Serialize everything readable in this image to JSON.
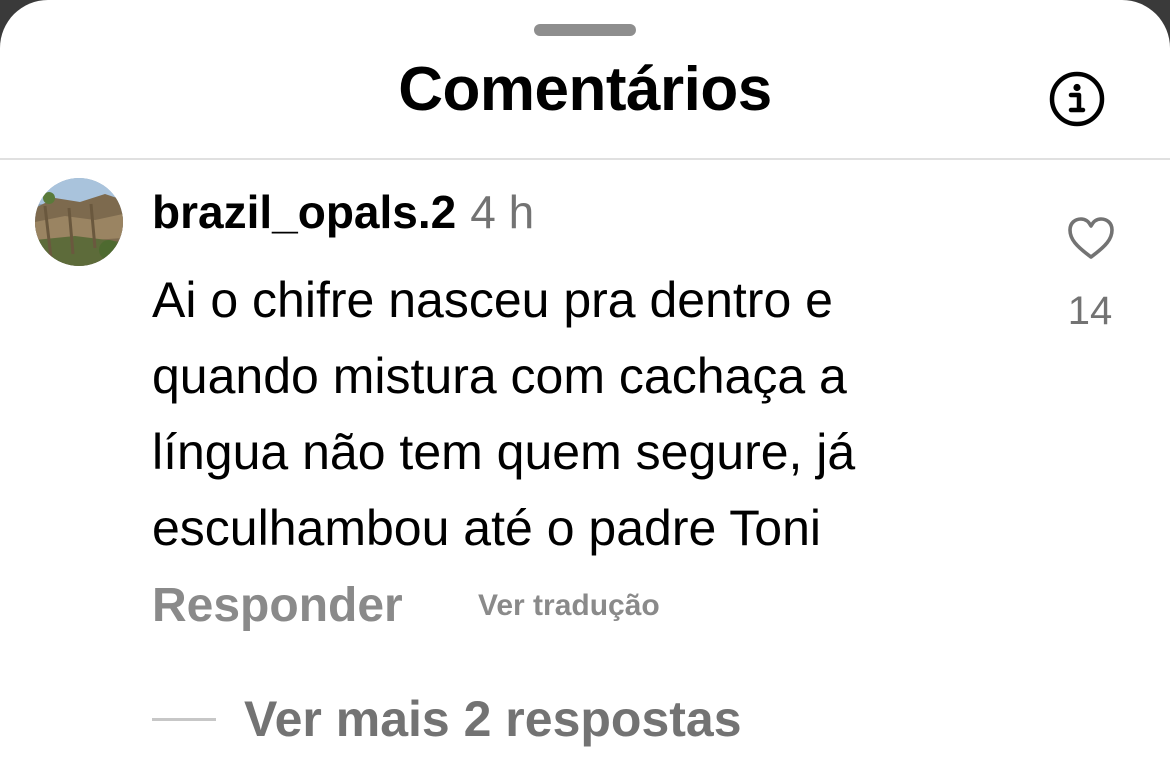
{
  "sheet": {
    "title": "Comentários",
    "info_icon": "info-circle-icon"
  },
  "comment": {
    "username": "brazil_opals.2",
    "time": "4 h",
    "text_lines": [
      "Ai o chifre nasceu pra dentro e",
      "quando mistura com cachaça a",
      "língua não tem quem segure, já",
      "esculhambou até o padre Toni"
    ],
    "like_icon": "heart-outline-icon",
    "like_count": "14",
    "reply_label": "Responder",
    "translate_label": "Ver tradução",
    "view_replies_label": "Ver mais 2 respostas"
  },
  "colors": {
    "primary_text": "#000000",
    "secondary_text": "#737373",
    "action_text": "#8a8a8a",
    "divider": "#e0e0e0",
    "background": "#ffffff"
  }
}
